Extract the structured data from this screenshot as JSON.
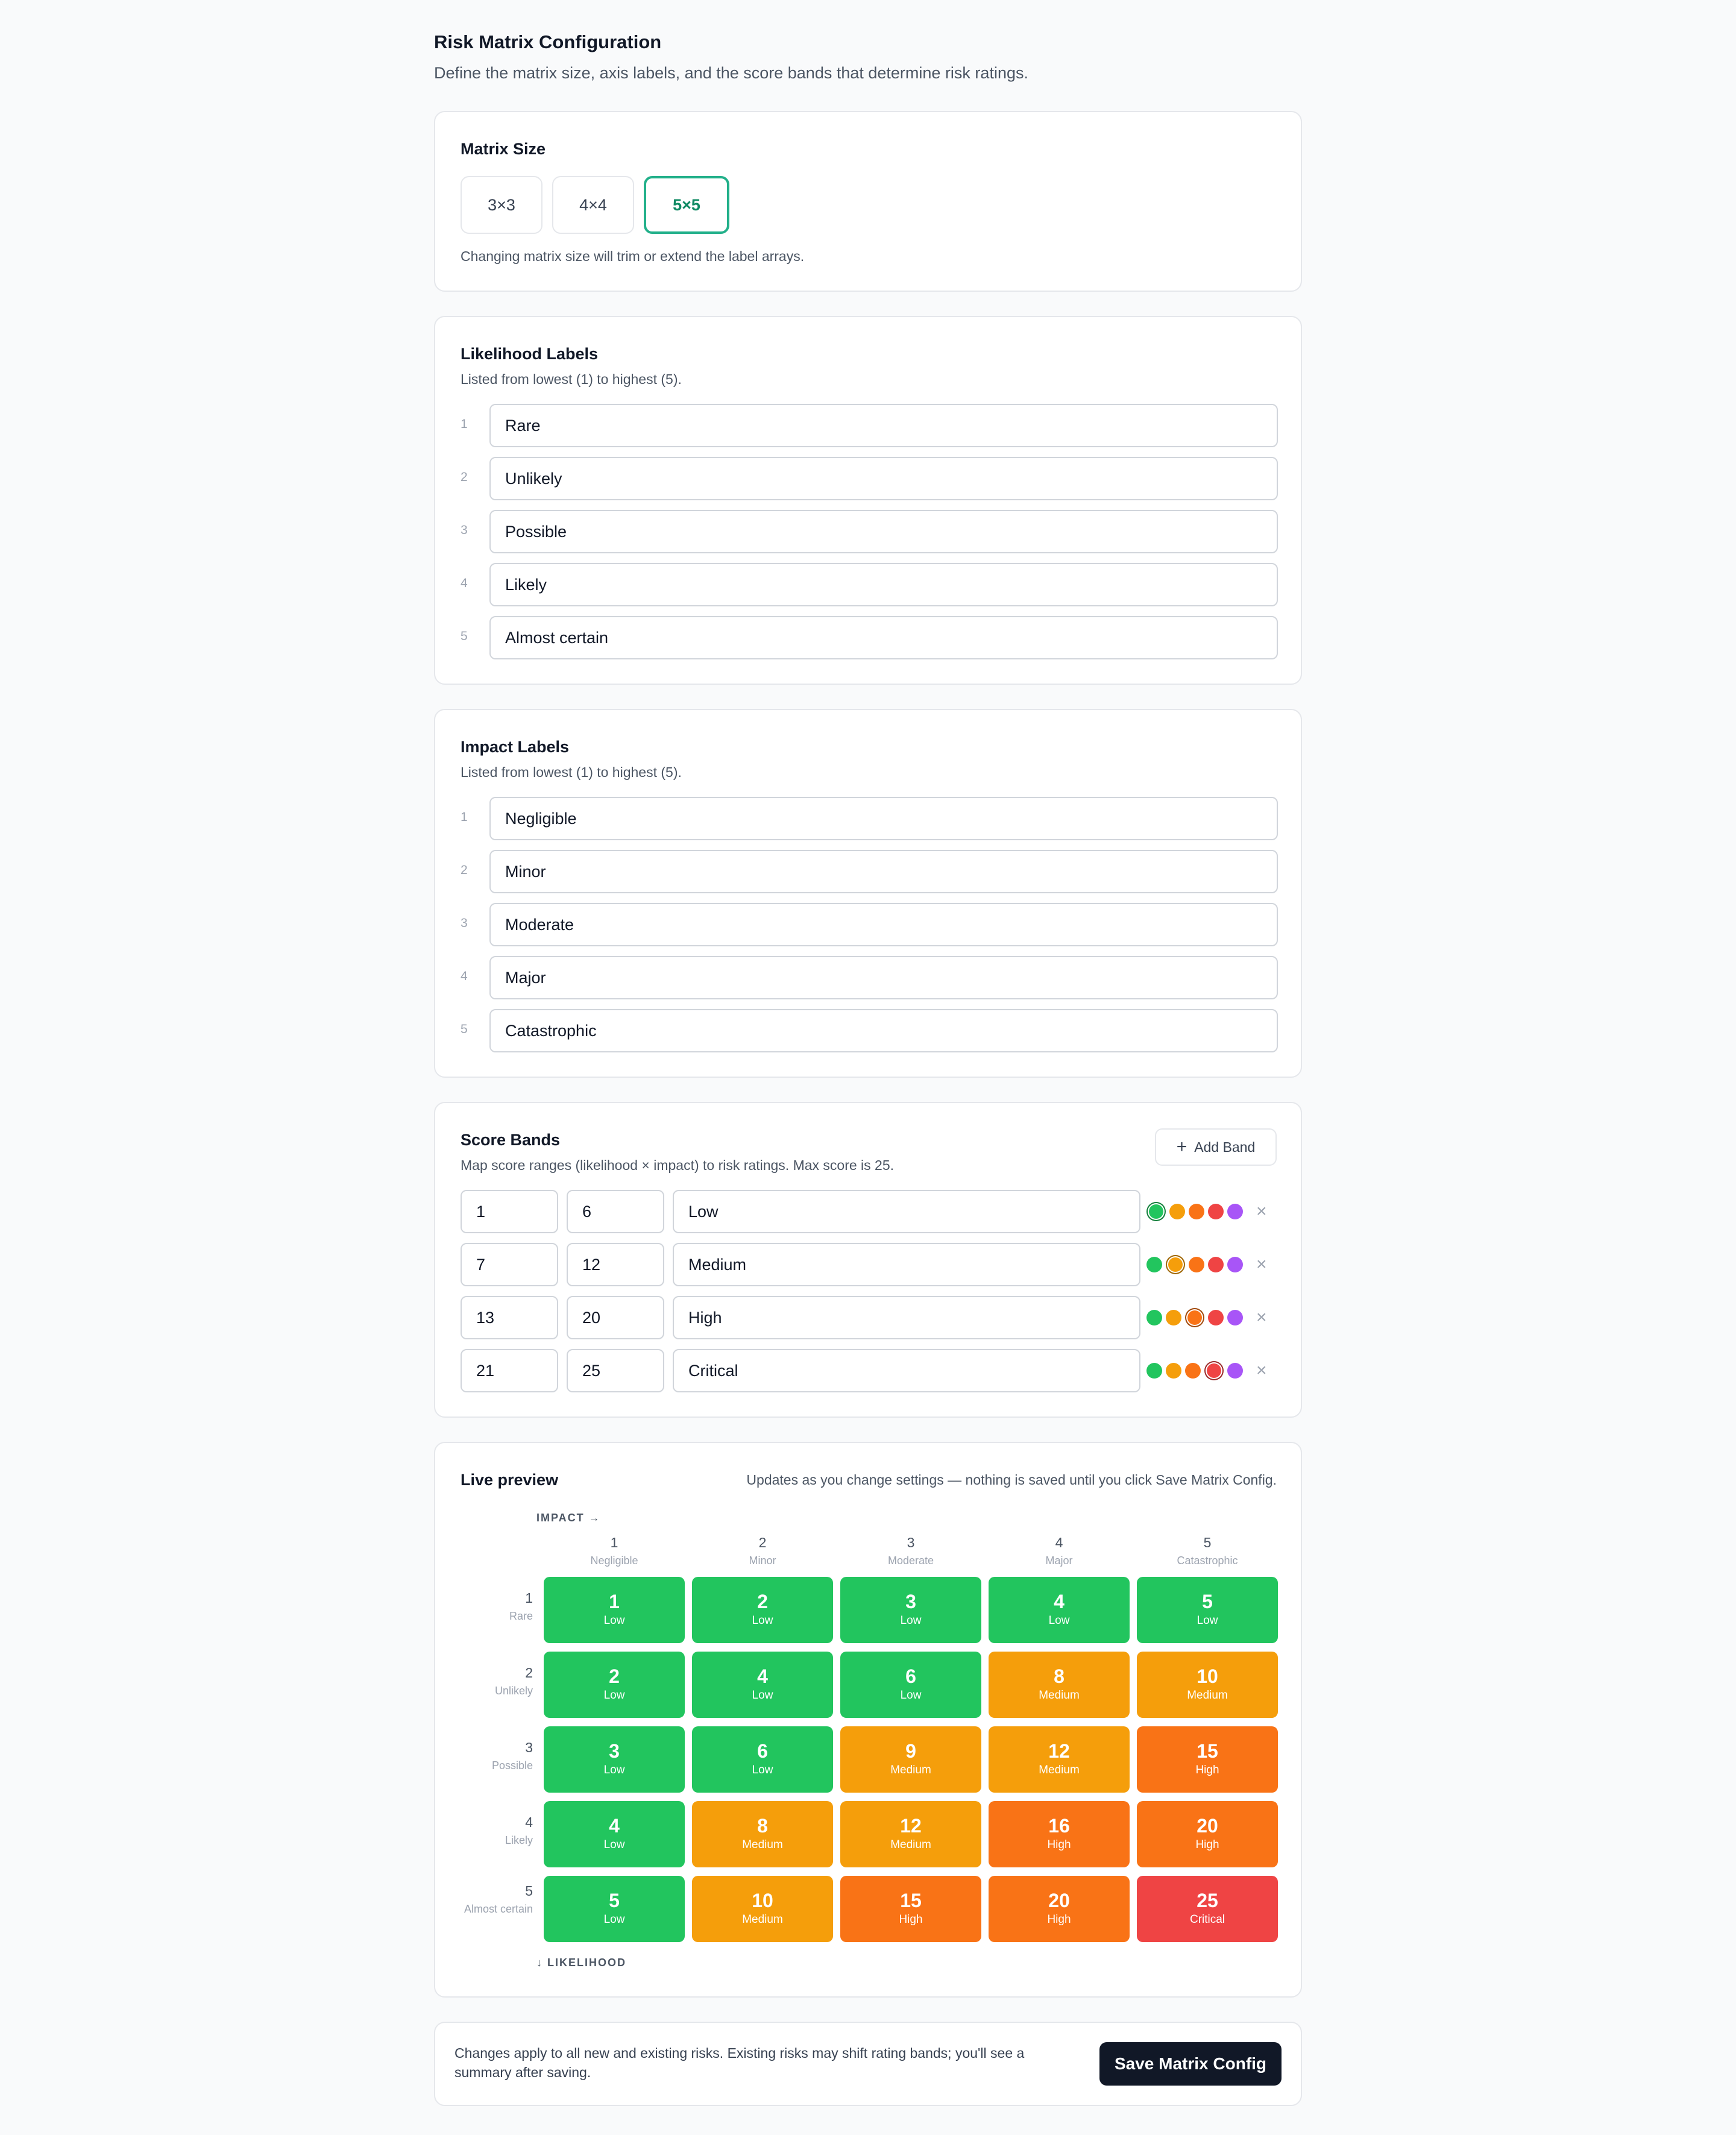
{
  "header": {
    "title": "Risk Matrix Configuration",
    "subtitle": "Define the matrix size, axis labels, and the score bands that determine risk ratings."
  },
  "matrix_size": {
    "title": "Matrix Size",
    "options": [
      "3×3",
      "4×4",
      "5×5"
    ],
    "selected": "5×5",
    "hint": "Changing matrix size will trim or extend the label arrays."
  },
  "likelihood": {
    "title": "Likelihood Labels",
    "subtitle": "Listed from lowest (1) to highest (5).",
    "numbers": [
      "1",
      "2",
      "3",
      "4",
      "5"
    ],
    "labels": [
      "Rare",
      "Unlikely",
      "Possible",
      "Likely",
      "Almost certain"
    ]
  },
  "impact": {
    "title": "Impact Labels",
    "subtitle": "Listed from lowest (1) to highest (5).",
    "numbers": [
      "1",
      "2",
      "3",
      "4",
      "5"
    ],
    "labels": [
      "Negligible",
      "Minor",
      "Moderate",
      "Major",
      "Catastrophic"
    ]
  },
  "score_bands": {
    "title": "Score Bands",
    "subtitle": "Map score ranges (likelihood × impact) to risk ratings. Max score is 25.",
    "add_label": "Add Band",
    "palette": [
      "#22c55e",
      "#f59e0b",
      "#f97316",
      "#ef4444",
      "#a855f7"
    ],
    "bands": [
      {
        "min": "1",
        "max": "6",
        "label": "Low",
        "color": "#22c55e"
      },
      {
        "min": "7",
        "max": "12",
        "label": "Medium",
        "color": "#f59e0b"
      },
      {
        "min": "13",
        "max": "20",
        "label": "High",
        "color": "#f97316"
      },
      {
        "min": "21",
        "max": "25",
        "label": "Critical",
        "color": "#ef4444"
      }
    ]
  },
  "preview": {
    "title": "Live preview",
    "note": "Updates as you change settings — nothing is saved until you click Save Matrix Config.",
    "impact_axis": "IMPACT →",
    "likelihood_axis": "↓ LIKELIHOOD",
    "rows": [
      {
        "num": "1",
        "label": "Rare",
        "cells": [
          {
            "score": "1",
            "band": "Low",
            "color": "#22c55e"
          },
          {
            "score": "2",
            "band": "Low",
            "color": "#22c55e"
          },
          {
            "score": "3",
            "band": "Low",
            "color": "#22c55e"
          },
          {
            "score": "4",
            "band": "Low",
            "color": "#22c55e"
          },
          {
            "score": "5",
            "band": "Low",
            "color": "#22c55e"
          }
        ]
      },
      {
        "num": "2",
        "label": "Unlikely",
        "cells": [
          {
            "score": "2",
            "band": "Low",
            "color": "#22c55e"
          },
          {
            "score": "4",
            "band": "Low",
            "color": "#22c55e"
          },
          {
            "score": "6",
            "band": "Low",
            "color": "#22c55e"
          },
          {
            "score": "8",
            "band": "Medium",
            "color": "#f59e0b"
          },
          {
            "score": "10",
            "band": "Medium",
            "color": "#f59e0b"
          }
        ]
      },
      {
        "num": "3",
        "label": "Possible",
        "cells": [
          {
            "score": "3",
            "band": "Low",
            "color": "#22c55e"
          },
          {
            "score": "6",
            "band": "Low",
            "color": "#22c55e"
          },
          {
            "score": "9",
            "band": "Medium",
            "color": "#f59e0b"
          },
          {
            "score": "12",
            "band": "Medium",
            "color": "#f59e0b"
          },
          {
            "score": "15",
            "band": "High",
            "color": "#f97316"
          }
        ]
      },
      {
        "num": "4",
        "label": "Likely",
        "cells": [
          {
            "score": "4",
            "band": "Low",
            "color": "#22c55e"
          },
          {
            "score": "8",
            "band": "Medium",
            "color": "#f59e0b"
          },
          {
            "score": "12",
            "band": "Medium",
            "color": "#f59e0b"
          },
          {
            "score": "16",
            "band": "High",
            "color": "#f97316"
          },
          {
            "score": "20",
            "band": "High",
            "color": "#f97316"
          }
        ]
      },
      {
        "num": "5",
        "label": "Almost certain",
        "cells": [
          {
            "score": "5",
            "band": "Low",
            "color": "#22c55e"
          },
          {
            "score": "10",
            "band": "Medium",
            "color": "#f59e0b"
          },
          {
            "score": "15",
            "band": "High",
            "color": "#f97316"
          },
          {
            "score": "20",
            "band": "High",
            "color": "#f97316"
          },
          {
            "score": "25",
            "band": "Critical",
            "color": "#ef4444"
          }
        ]
      }
    ]
  },
  "footer": {
    "text": "Changes apply to all new and existing risks. Existing risks may shift rating bands; you'll see a summary after saving.",
    "save_label": "Save Matrix Config"
  }
}
